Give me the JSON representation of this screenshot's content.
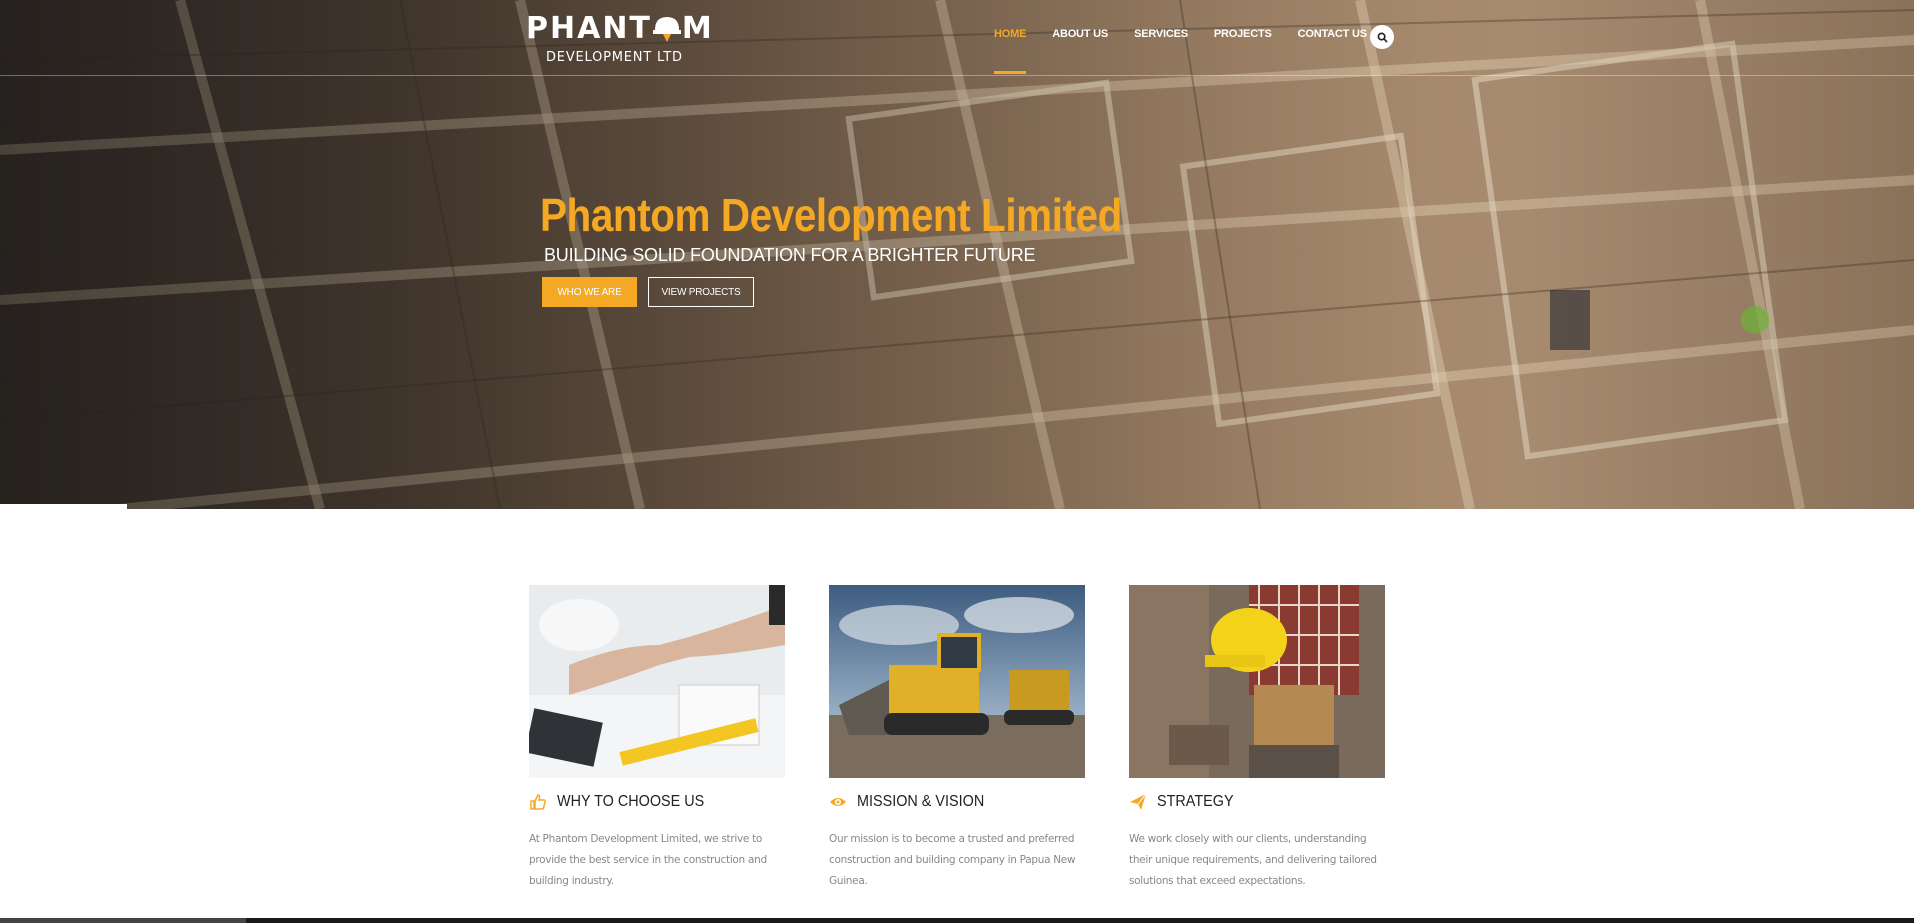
{
  "brand": {
    "name": "PHANTOM",
    "tagline": "DEVELOPMENT LTD"
  },
  "nav": {
    "items": [
      {
        "label": "HOME",
        "active": true
      },
      {
        "label": "ABOUT US",
        "active": false
      },
      {
        "label": "SERVICES",
        "active": false
      },
      {
        "label": "PROJECTS",
        "active": false
      },
      {
        "label": "CONTACT US",
        "active": false
      }
    ],
    "search_icon": "search-icon"
  },
  "hero": {
    "title": "Phantom Development Limited",
    "subtitle": "BUILDING SOLID FOUNDATION FOR A BRIGHTER FUTURE",
    "primary_button": "WHO WE ARE",
    "secondary_button": "VIEW PROJECTS"
  },
  "features": [
    {
      "icon": "thumbs-up-icon",
      "title": "WHY TO CHOOSE US",
      "text": "At Phantom Development Limited, we strive to provide the best service in the construction and building industry."
    },
    {
      "icon": "eye-icon",
      "title": "MISSION & VISION",
      "text": "Our mission is to become a trusted and preferred construction and building company in Papua New Guinea."
    },
    {
      "icon": "paper-plane-icon",
      "title": "STRATEGY",
      "text": "We work closely with our clients, understanding their unique requirements, and delivering tailored solutions that exceed expectations."
    }
  ],
  "colors": {
    "accent": "#f5a823",
    "text_dark": "#222222",
    "text_muted": "#888888"
  }
}
